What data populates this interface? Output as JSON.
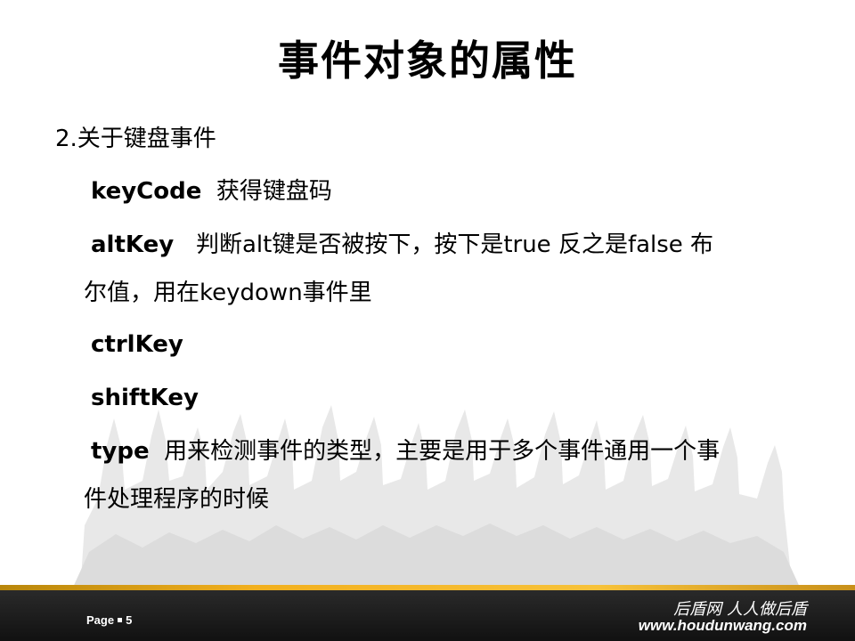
{
  "slide": {
    "title": "事件对象的属性",
    "lines": [
      {
        "text": "2.关于键盘事件"
      },
      {
        "key": "keyCode",
        "desc": "获得键盘码"
      },
      {
        "key": "altKey",
        "desc": "判断alt键是否被按下，按下是true 反之是false   布"
      },
      {
        "text": "尔值，用在keydown事件里"
      },
      {
        "key": "ctrlKey",
        "desc": ""
      },
      {
        "key": "shiftKey",
        "desc": ""
      },
      {
        "key": "type",
        "desc": "用来检测事件的类型，主要是用于多个事件通用一个事"
      },
      {
        "text": "件处理程序的时候"
      }
    ]
  },
  "footer": {
    "page_label": "Page",
    "page_number": "5",
    "brand_cn": "后盾网 人人做后盾",
    "brand_url": "www.houdunwang.com"
  },
  "colors": {
    "footer_bar": "#1a1a1a",
    "footer_stripe": "#f2b01e",
    "crowd": "#e6e6e6"
  }
}
